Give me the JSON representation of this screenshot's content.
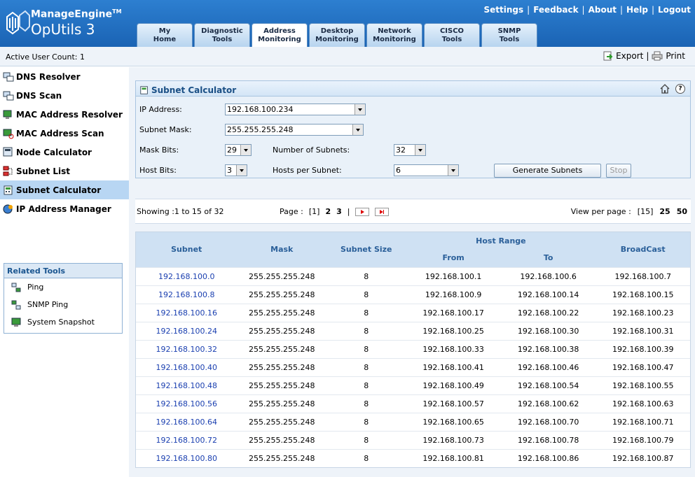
{
  "header": {
    "brand_top": "ManageEngine",
    "trademark": "TM",
    "brand_bottom": "OpUtils 3",
    "links": [
      "Settings",
      "Feedback",
      "About",
      "Help",
      "Logout"
    ],
    "tabs": [
      {
        "line1": "My",
        "line2": "Home"
      },
      {
        "line1": "Diagnostic",
        "line2": "Tools"
      },
      {
        "line1": "Address",
        "line2": "Monitoring",
        "active": true
      },
      {
        "line1": "Desktop",
        "line2": "Monitoring"
      },
      {
        "line1": "Network",
        "line2": "Monitoring"
      },
      {
        "line1": "CISCO",
        "line2": "Tools"
      },
      {
        "line1": "SNMP",
        "line2": "Tools"
      }
    ]
  },
  "toolbar": {
    "active_user": "Active User Count: 1",
    "export": "Export",
    "separator": "|",
    "print": "Print"
  },
  "sidebar": {
    "items": [
      {
        "label": "DNS Resolver",
        "icon": "dns-resolver-icon"
      },
      {
        "label": "DNS Scan",
        "icon": "dns-scan-icon"
      },
      {
        "label": "MAC Address Resolver",
        "icon": "mac-resolver-icon"
      },
      {
        "label": "MAC Address Scan",
        "icon": "mac-scan-icon"
      },
      {
        "label": "Node Calculator",
        "icon": "node-calculator-icon"
      },
      {
        "label": "Subnet List",
        "icon": "subnet-list-icon"
      },
      {
        "label": "Subnet Calculator",
        "icon": "subnet-calculator-icon",
        "active": true
      },
      {
        "label": "IP Address Manager",
        "icon": "ip-address-manager-icon"
      }
    ],
    "related_title": "Related Tools",
    "related": [
      {
        "label": "Ping",
        "icon": "ping-icon"
      },
      {
        "label": "SNMP Ping",
        "icon": "snmp-ping-icon"
      },
      {
        "label": "System Snapshot",
        "icon": "system-snapshot-icon"
      }
    ]
  },
  "calculator": {
    "title": "Subnet Calculator",
    "help": "?",
    "ip_label": "IP Address:",
    "ip_value": "192.168.100.234",
    "mask_label": "Subnet Mask:",
    "mask_value": "255.255.255.248",
    "mask_bits_label": "Mask Bits:",
    "mask_bits_value": "29",
    "num_subnets_label": "Number of Subnets:",
    "num_subnets_value": "32",
    "host_bits_label": "Host Bits:",
    "host_bits_value": "3",
    "hosts_per_subnet_label": "Hosts per Subnet:",
    "hosts_per_subnet_value": "6",
    "generate_label": "Generate Subnets",
    "stop_label": "Stop"
  },
  "pager": {
    "showing": "Showing :1 to 15 of 32",
    "page_label": "Page :",
    "current_page": "[1]",
    "pages": [
      "2",
      "3"
    ],
    "separator": "|",
    "view_label": "View per page :",
    "view_current": "[15]",
    "view_options": [
      "25",
      "50"
    ]
  },
  "table": {
    "headers": {
      "subnet": "Subnet",
      "mask": "Mask",
      "size": "Subnet Size",
      "host_range": "Host Range",
      "from": "From",
      "to": "To",
      "broadcast": "BroadCast"
    },
    "rows": [
      [
        "192.168.100.0",
        "255.255.255.248",
        "8",
        "192.168.100.1",
        "192.168.100.6",
        "192.168.100.7"
      ],
      [
        "192.168.100.8",
        "255.255.255.248",
        "8",
        "192.168.100.9",
        "192.168.100.14",
        "192.168.100.15"
      ],
      [
        "192.168.100.16",
        "255.255.255.248",
        "8",
        "192.168.100.17",
        "192.168.100.22",
        "192.168.100.23"
      ],
      [
        "192.168.100.24",
        "255.255.255.248",
        "8",
        "192.168.100.25",
        "192.168.100.30",
        "192.168.100.31"
      ],
      [
        "192.168.100.32",
        "255.255.255.248",
        "8",
        "192.168.100.33",
        "192.168.100.38",
        "192.168.100.39"
      ],
      [
        "192.168.100.40",
        "255.255.255.248",
        "8",
        "192.168.100.41",
        "192.168.100.46",
        "192.168.100.47"
      ],
      [
        "192.168.100.48",
        "255.255.255.248",
        "8",
        "192.168.100.49",
        "192.168.100.54",
        "192.168.100.55"
      ],
      [
        "192.168.100.56",
        "255.255.255.248",
        "8",
        "192.168.100.57",
        "192.168.100.62",
        "192.168.100.63"
      ],
      [
        "192.168.100.64",
        "255.255.255.248",
        "8",
        "192.168.100.65",
        "192.168.100.70",
        "192.168.100.71"
      ],
      [
        "192.168.100.72",
        "255.255.255.248",
        "8",
        "192.168.100.73",
        "192.168.100.78",
        "192.168.100.79"
      ],
      [
        "192.168.100.80",
        "255.255.255.248",
        "8",
        "192.168.100.81",
        "192.168.100.86",
        "192.168.100.87"
      ]
    ]
  }
}
